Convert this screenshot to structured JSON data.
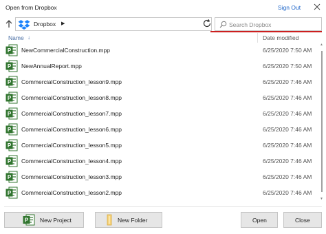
{
  "dialog": {
    "title": "Open from Dropbox",
    "sign_out": "Sign Out",
    "close_icon": "close-icon"
  },
  "nav": {
    "up_icon": "arrow-up-icon",
    "location_icon": "dropbox-icon",
    "breadcrumb": "Dropbox",
    "breadcrumb_chevron": "▶",
    "refresh_icon": "refresh-icon",
    "search_placeholder": "Search Dropbox",
    "search_value": "",
    "accent_color": "#cc1f1f"
  },
  "columns": {
    "name": "Name",
    "sort_indicator": "↓",
    "date": "Date modified"
  },
  "files": [
    {
      "name": "NewCommercialConstruction.mpp",
      "date": "6/25/2020 7:50 AM"
    },
    {
      "name": "NewAnnualReport.mpp",
      "date": "6/25/2020 7:50 AM"
    },
    {
      "name": "CommercialConstruction_lesson9.mpp",
      "date": "6/25/2020 7:46 AM"
    },
    {
      "name": "CommercialConstruction_lesson8.mpp",
      "date": "6/25/2020 7:46 AM"
    },
    {
      "name": "CommercialConstruction_lesson7.mpp",
      "date": "6/25/2020 7:46 AM"
    },
    {
      "name": "CommercialConstruction_lesson6.mpp",
      "date": "6/25/2020 7:46 AM"
    },
    {
      "name": "CommercialConstruction_lesson5.mpp",
      "date": "6/25/2020 7:46 AM"
    },
    {
      "name": "CommercialConstruction_lesson4.mpp",
      "date": "6/25/2020 7:46 AM"
    },
    {
      "name": "CommercialConstruction_lesson3.mpp",
      "date": "6/25/2020 7:46 AM"
    },
    {
      "name": "CommercialConstruction_lesson2.mpp",
      "date": "6/25/2020 7:46 AM"
    }
  ],
  "file_icon": "project-file-icon",
  "buttons": {
    "new_project": "New Project",
    "new_project_icon": "project-file-icon",
    "new_folder": "New Folder",
    "new_folder_icon": "folder-icon",
    "open": "Open",
    "close": "Close"
  }
}
